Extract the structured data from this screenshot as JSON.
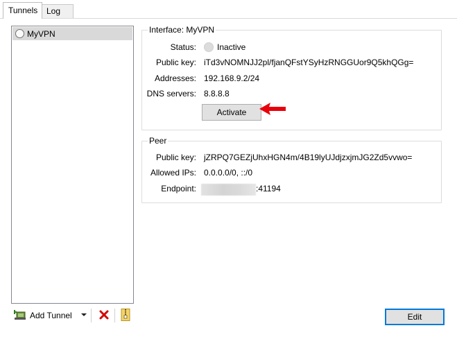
{
  "tabs": [
    {
      "label": "Tunnels",
      "active": true
    },
    {
      "label": "Log",
      "active": false
    }
  ],
  "tunnels": [
    {
      "name": "MyVPN",
      "selected": true
    }
  ],
  "toolbar": {
    "add_label": "Add Tunnel",
    "add_icon": "add-tunnel-icon",
    "delete_icon": "delete-x-icon",
    "export_icon": "zip-export-icon"
  },
  "interface": {
    "title": "Interface: MyVPN",
    "status_label": "Status:",
    "status_value": "Inactive",
    "public_key_label": "Public key:",
    "public_key_value": "iTd3vNOMNJJ2pl/fjanQFstYSyHzRNGGUor9Q5khQGg=",
    "addresses_label": "Addresses:",
    "addresses_value": "192.168.9.2/24",
    "dns_label": "DNS servers:",
    "dns_value": "8.8.8.8",
    "activate_label": "Activate"
  },
  "peer": {
    "title": "Peer",
    "public_key_label": "Public key:",
    "public_key_value": "jZRPQ7GEZjUhxHGN4m/4B19lyUJdjzxjmJG2Zd5vvwo=",
    "allowed_ips_label": "Allowed IPs:",
    "allowed_ips_value": "0.0.0.0/0, ::/0",
    "endpoint_label": "Endpoint:",
    "endpoint_port": ":41194"
  },
  "edit_label": "Edit",
  "colors": {
    "annotation_arrow": "#e8000b",
    "selection": "#d9d9d9",
    "focus_border": "#0078d7",
    "delete_red": "#d40000"
  }
}
